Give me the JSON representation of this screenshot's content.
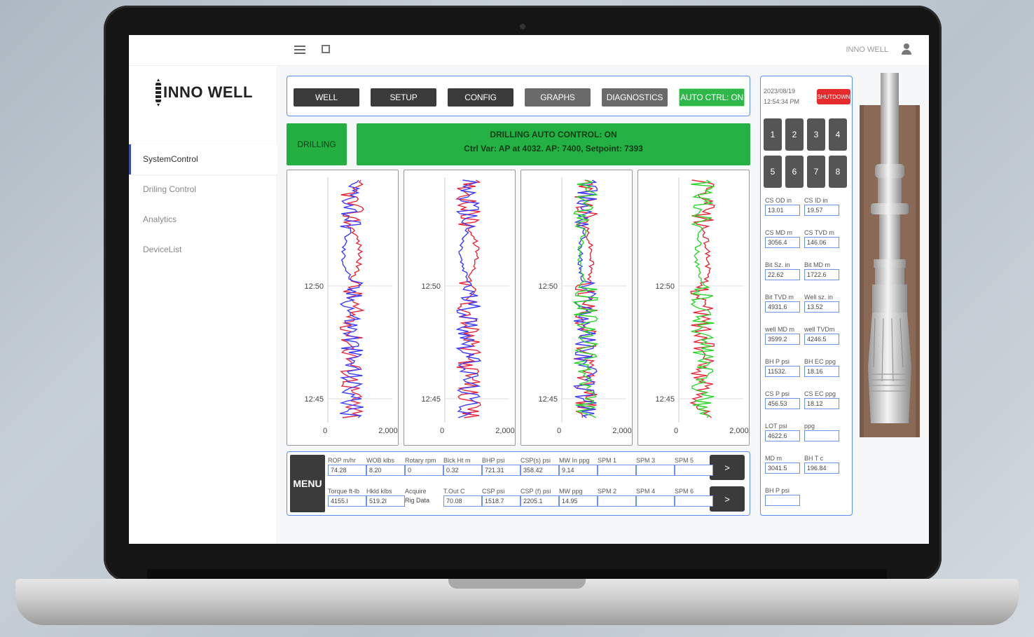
{
  "app": {
    "brand": "INNO WELL",
    "user": "INNO WELL"
  },
  "sidebar": {
    "items": [
      {
        "label": "SystemControl",
        "active": true
      },
      {
        "label": "Driling Control",
        "active": false
      },
      {
        "label": "Analytics",
        "active": false
      },
      {
        "label": "DeviceList",
        "active": false
      }
    ]
  },
  "toolbar": {
    "buttons": [
      "WELL",
      "SETUP",
      "CONFIG",
      "GRAPHS",
      "DIAGNOSTICS",
      "AUTO CTRL: ON"
    ]
  },
  "status": {
    "mode": "DRILLING",
    "line1": "DRILLING AUTO CONTROL: ON",
    "line2": "Ctrl Var: AP at 4032. AP: 7400, Setpoint: 7393"
  },
  "charts": {
    "time_labels": [
      "12:50",
      "12:45"
    ],
    "x_min": "0",
    "x_max": "2,000",
    "colors": {
      "red": "#e8283a",
      "blue": "#3b3bff",
      "green": "#2bd62b"
    }
  },
  "chart_data": [
    {
      "type": "line",
      "xlim": [
        0,
        2000
      ],
      "y_ticks": [
        "12:50",
        "12:45"
      ],
      "series": [
        {
          "color": "red"
        },
        {
          "color": "blue"
        }
      ]
    },
    {
      "type": "line",
      "xlim": [
        0,
        2000
      ],
      "y_ticks": [
        "12:50",
        "12:45"
      ],
      "series": [
        {
          "color": "red"
        },
        {
          "color": "blue"
        }
      ]
    },
    {
      "type": "line",
      "xlim": [
        0,
        2000
      ],
      "y_ticks": [
        "12:50",
        "12:45"
      ],
      "series": [
        {
          "color": "red"
        },
        {
          "color": "blue"
        },
        {
          "color": "green"
        }
      ]
    },
    {
      "type": "line",
      "xlim": [
        0,
        2000
      ],
      "y_ticks": [
        "12:50",
        "12:45"
      ],
      "series": [
        {
          "color": "red"
        },
        {
          "color": "green"
        }
      ]
    }
  ],
  "bottom": {
    "menu_label": "MENU",
    "arrow_label": ">",
    "row1": [
      {
        "label": "ROP  m/hr",
        "value": "74.28"
      },
      {
        "label": "WOB  klbs",
        "value": "8.20"
      },
      {
        "label": "Rotary rpm",
        "value": "0"
      },
      {
        "label": "Blck Ht  m",
        "value": "0.32"
      },
      {
        "label": "BHP   psi",
        "value": "721.31"
      },
      {
        "label": "CSP(s) psi",
        "value": "358.42"
      },
      {
        "label": "MW In ppg",
        "value": "9.14"
      },
      {
        "label": "SPM 1",
        "value": ""
      },
      {
        "label": "SPM 3",
        "value": ""
      },
      {
        "label": "SPM 5",
        "value": ""
      }
    ],
    "row2": [
      {
        "label": "Torque ft-lb",
        "value": "4155.I"
      },
      {
        "label": "Hkld  klbs",
        "value": "519.2I"
      },
      {
        "label": "Acquire",
        "value": "Rig Data"
      },
      {
        "label": "T.Out   C",
        "value": "70.08"
      },
      {
        "label": "CSP   psi",
        "value": "1518.7"
      },
      {
        "label": "CSP (f) psi",
        "value": "2205.1"
      },
      {
        "label": "MW   ppg",
        "value": "14.95"
      },
      {
        "label": "SPM 2",
        "value": ""
      },
      {
        "label": "SPM 4",
        "value": ""
      },
      {
        "label": "SPM 6",
        "value": ""
      }
    ]
  },
  "right": {
    "date": "2023/08/19",
    "time": "12:54:34 PM",
    "shutdown": "SHUTDOWN",
    "numbers": [
      "1",
      "2",
      "3",
      "4",
      "5",
      "6",
      "7",
      "8"
    ],
    "fields": [
      {
        "label": "CS OD   in",
        "value": "13.01"
      },
      {
        "label": "CS ID   in",
        "value": "19.57"
      },
      {
        "label": "CS MD   m",
        "value": "3056.4"
      },
      {
        "label": "CS TVD  m",
        "value": "146.06"
      },
      {
        "label": "Bit Sz.  in",
        "value": "22.62"
      },
      {
        "label": "Bit MD   m",
        "value": "1722.6"
      },
      {
        "label": "Bit TVD  m",
        "value": "4931.6"
      },
      {
        "label": "Well sz.  in",
        "value": "13.52"
      },
      {
        "label": "well MD  m",
        "value": "3599.2"
      },
      {
        "label": "well TVDm",
        "value": "4246.5"
      },
      {
        "label": "BH P   psi",
        "value": "11532."
      },
      {
        "label": "BH EC ppg",
        "value": "18.16"
      },
      {
        "label": "CS P   psi",
        "value": "456.53"
      },
      {
        "label": "CS EC ppg",
        "value": "18.12"
      },
      {
        "label": "LOT   psi",
        "value": "4622.6"
      },
      {
        "label": "         ppg",
        "value": ""
      },
      {
        "label": "MD      m",
        "value": "3041.5"
      },
      {
        "label": "BH T    c",
        "value": "196.84"
      },
      {
        "label": "BH P   psi",
        "value": ""
      }
    ]
  }
}
